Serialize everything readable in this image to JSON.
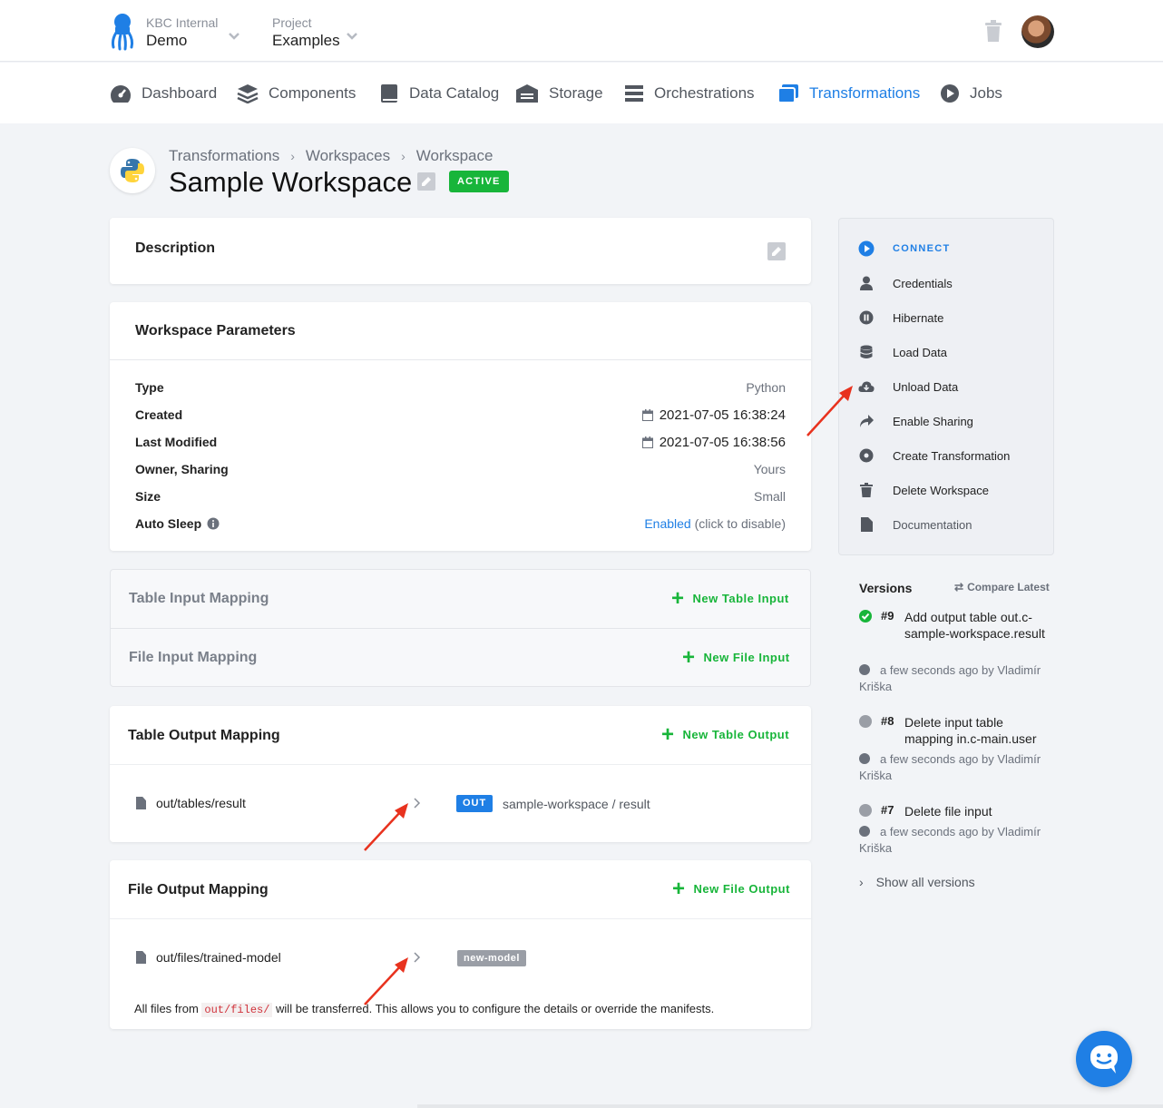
{
  "header": {
    "org_label": "KBC Internal",
    "org_value": "Demo",
    "project_label": "Project",
    "project_value": "Examples"
  },
  "nav": [
    {
      "label": "Dashboard",
      "icon": "dashboard-icon"
    },
    {
      "label": "Components",
      "icon": "layers-icon"
    },
    {
      "label": "Data Catalog",
      "icon": "book-icon"
    },
    {
      "label": "Storage",
      "icon": "warehouse-icon"
    },
    {
      "label": "Orchestrations",
      "icon": "bars-icon"
    },
    {
      "label": "Transformations",
      "icon": "window-icon",
      "active": true
    },
    {
      "label": "Jobs",
      "icon": "play-circle-icon"
    }
  ],
  "breadcrumb": [
    "Transformations",
    "Workspaces",
    "Workspace"
  ],
  "page": {
    "title": "Sample Workspace",
    "status": "ACTIVE"
  },
  "description": {
    "title": "Description"
  },
  "parameters": {
    "title": "Workspace Parameters",
    "rows": [
      {
        "key": "Type",
        "value": "Python"
      },
      {
        "key": "Created",
        "value": "2021-07-05 16:38:24"
      },
      {
        "key": "Last Modified",
        "value": "2021-07-05 16:38:56"
      },
      {
        "key": "Owner, Sharing",
        "value": "Yours"
      },
      {
        "key": "Size",
        "value": "Small"
      },
      {
        "key": "Auto Sleep",
        "value_link": "Enabled",
        "value_suffix": " (click to disable)"
      }
    ]
  },
  "input_mapping": {
    "table_title": "Table Input Mapping",
    "table_action": "New Table Input",
    "file_title": "File Input Mapping",
    "file_action": "New File Input"
  },
  "table_output": {
    "title": "Table Output Mapping",
    "action": "New Table Output",
    "source": "out/tables/result",
    "badge": "OUT",
    "destination": "sample-workspace / result"
  },
  "file_output": {
    "title": "File Output Mapping",
    "action": "New File Output",
    "source": "out/files/trained-model",
    "tag": "new-model",
    "note_prefix": "All files from ",
    "note_code": "out/files/",
    "note_suffix": " will be transferred. This allows you to configure the details or override the manifests."
  },
  "sidebar": [
    {
      "label": "CONNECT",
      "icon": "play-circle-icon"
    },
    {
      "label": "Credentials",
      "icon": "user-icon"
    },
    {
      "label": "Hibernate",
      "icon": "pause-circle-icon"
    },
    {
      "label": "Load Data",
      "icon": "database-icon"
    },
    {
      "label": "Unload Data",
      "icon": "cloud-download-icon"
    },
    {
      "label": "Enable Sharing",
      "icon": "share-icon"
    },
    {
      "label": "Create Transformation",
      "icon": "gear-icon"
    },
    {
      "label": "Delete Workspace",
      "icon": "trash-icon"
    },
    {
      "label": "Documentation",
      "icon": "document-icon"
    }
  ],
  "versions": {
    "title": "Versions",
    "compare": "Compare Latest",
    "items": [
      {
        "num": "#9",
        "message": "Add output table out.c-sample-workspace.result",
        "meta": "a few seconds ago by Vladimír Kriška",
        "status_color": "#18b53a"
      },
      {
        "num": "#8",
        "message": "Delete input table mapping in.c-main.user",
        "meta": "a few seconds ago by Vladimír Kriška",
        "status_color": "#9a9ea6"
      },
      {
        "num": "#7",
        "message": "Delete file input",
        "meta": "a few seconds ago by Vladimír Kriška",
        "status_color": "#9a9ea6"
      }
    ],
    "show_all": "Show all versions"
  },
  "colors": {
    "accent": "#1f7fe5",
    "success": "#18b53a",
    "annotation": "#e8321e"
  }
}
